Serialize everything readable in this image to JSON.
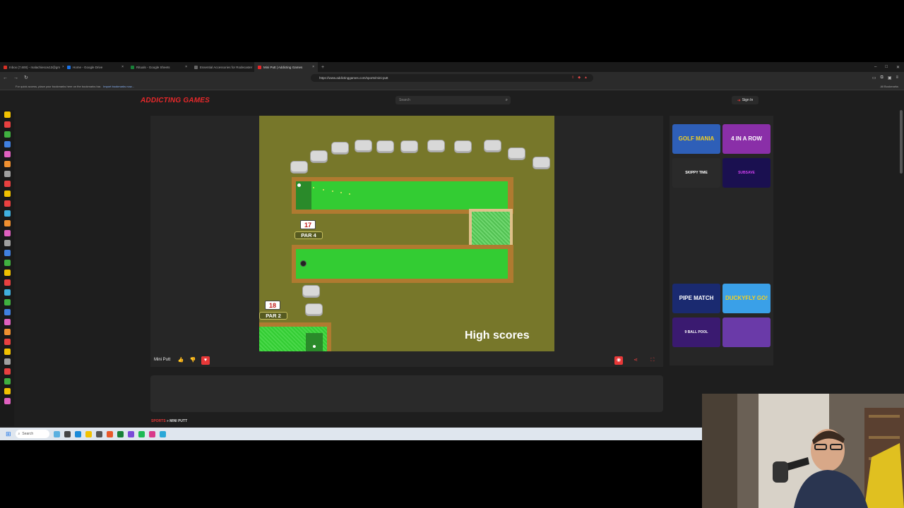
{
  "browser": {
    "tabs": [
      {
        "title": "Inbox (7,600) - malachiescw13@gm",
        "active": false,
        "color": "#d93025"
      },
      {
        "title": "Home - Google Drive",
        "active": false,
        "color": "#1a73e8"
      },
      {
        "title": "Rituals - Google Sheets",
        "active": false,
        "color": "#188038"
      },
      {
        "title": "Essential Accessories for Rodecaster",
        "active": false,
        "color": "#666666"
      },
      {
        "title": "Mini Putt | Addicting Games",
        "active": true,
        "color": "#e8282a"
      }
    ],
    "new_tab": "+",
    "url": "https://www.addictinggames.com/sports/mini-putt",
    "bookmarks_hint": "For quick access, place your bookmarks here on the bookmarks bar.",
    "bookmarks_link": "Import bookmarks now...",
    "all_bookmarks": "All Bookmarks"
  },
  "site": {
    "logo": "ADDICTING GAMES",
    "search_placeholder": "Search",
    "signin": "Sign In",
    "accent": "#e8282a"
  },
  "game": {
    "title": "Mini Putt",
    "hole_a": {
      "number": "17",
      "par": "PAR 4"
    },
    "hole_b": {
      "number": "18",
      "par": "PAR 2"
    },
    "high_scores": "High scores"
  },
  "recommendations": [
    {
      "label": "GOLF MANIA",
      "bg": "#2e5fb8"
    },
    {
      "label": "4 IN A ROW",
      "bg": "#8a2fa8"
    },
    {
      "label": "SKIPPY TIME",
      "bg": "#2a2a2a"
    },
    {
      "label": "SUBSAVE",
      "bg": "#1a1050"
    },
    {
      "label": "PIPE MATCH",
      "bg": "#1a2a70"
    },
    {
      "label": "DUCKYFLY GO!",
      "bg": "#3aa0e8"
    },
    {
      "label": "9 BALL POOL",
      "bg": "#3a1a70"
    },
    {
      "label": "",
      "bg": "#6a3aa8"
    }
  ],
  "breadcrumb": {
    "category": "SPORTS",
    "separator": "»",
    "page": "MINI PUTT"
  },
  "taskbar": {
    "search": "Search"
  }
}
